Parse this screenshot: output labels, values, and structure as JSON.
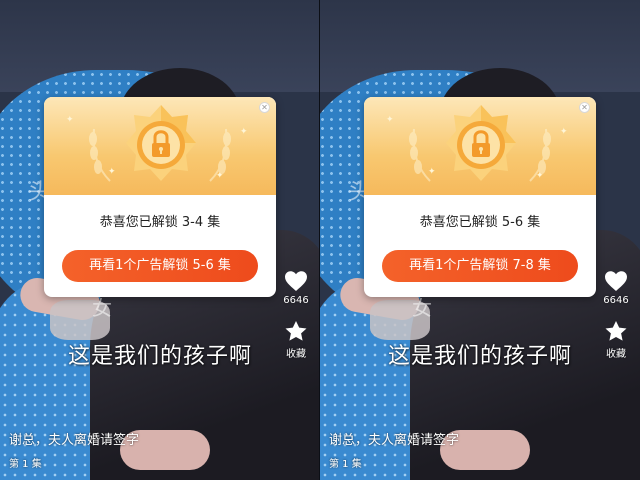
{
  "panels": [
    {
      "popup": {
        "message": "恭喜您已解锁 3-4 集",
        "button": "再看1个广告解锁 5-6 集",
        "close_icon": "close-icon",
        "badge_icon": "lock-medal-icon"
      },
      "subtitle": "这是我们的孩子啊",
      "background_text": [
        "头",
        "女"
      ],
      "actions": {
        "like_count": "6646",
        "like_icon": "heart-icon",
        "favorite_label": "收藏",
        "favorite_icon": "star-icon"
      },
      "drama_title": "谢总，夫人离婚请签字",
      "episode": "第 1 集"
    },
    {
      "popup": {
        "message": "恭喜您已解锁 5-6 集",
        "button": "再看1个广告解锁 7-8 集",
        "close_icon": "close-icon",
        "badge_icon": "lock-medal-icon"
      },
      "subtitle": "这是我们的孩子啊",
      "background_text": [
        "头",
        "女"
      ],
      "actions": {
        "like_count": "6646",
        "like_icon": "heart-icon",
        "favorite_label": "收藏",
        "favorite_icon": "star-icon"
      },
      "drama_title": "谢总，夫人离婚请签字",
      "episode": "第 1 集"
    }
  ],
  "colors": {
    "button_orange": "#f05a24",
    "medal_gold": "#f6b14a",
    "popup_top": "#f8c870"
  }
}
